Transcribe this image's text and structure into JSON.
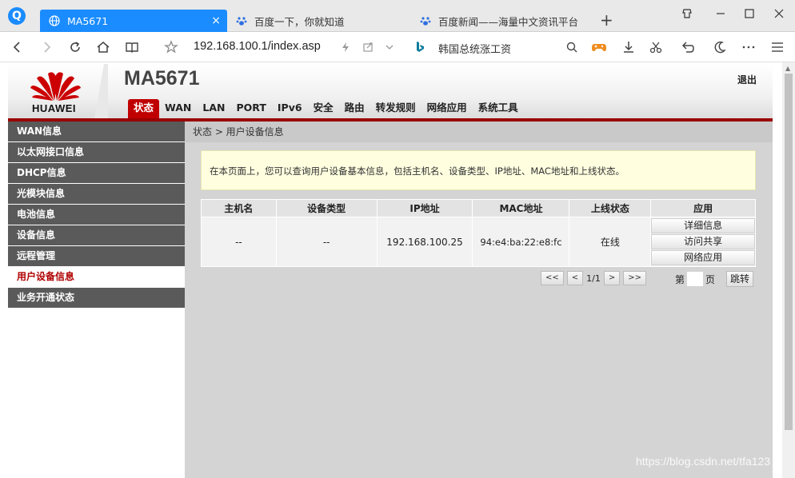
{
  "browser": {
    "logo": "Q",
    "tabs": [
      {
        "label": "MA5671",
        "close": "×"
      },
      {
        "label": "百度一下，你就知道"
      },
      {
        "label": "百度新闻——海量中文资讯平台"
      }
    ],
    "new_tab": "+",
    "url": "192.168.100.1/index.asp",
    "search_text": "韩国总统涨工资",
    "accent": "#1a8cff"
  },
  "header": {
    "brand": "HUAWEI",
    "model": "MA5671",
    "logout": "退出",
    "nav": [
      "状态",
      "WAN",
      "LAN",
      "PORT",
      "IPv6",
      "安全",
      "路由",
      "转发规则",
      "网络应用",
      "系统工具"
    ]
  },
  "sidebar": {
    "items": [
      "WAN信息",
      "以太网接口信息",
      "DHCP信息",
      "光模块信息",
      "电池信息",
      "设备信息",
      "远程管理",
      "用户设备信息",
      "业务开通状态"
    ]
  },
  "content": {
    "breadcrumb": "状态 > 用户设备信息",
    "info": "在本页面上，您可以查询用户设备基本信息，包括主机名、设备类型、IP地址、MAC地址和上线状态。",
    "table": {
      "headers": [
        "主机名",
        "设备类型",
        "IP地址",
        "MAC地址",
        "上线状态",
        "应用"
      ],
      "rows": [
        {
          "host": "--",
          "type": "--",
          "ip": "192.168.100.25",
          "mac": "94:e4:ba:22:e8:fc",
          "status": "在线"
        }
      ],
      "app_buttons": [
        "详细信息",
        "访问共享",
        "网络应用"
      ]
    },
    "pager": {
      "first": "<<",
      "prev": "<",
      "page": "1/1",
      "next": ">",
      "last": ">>",
      "goto_prefix": "第",
      "goto_suffix": "页",
      "goto_button": "跳转"
    }
  },
  "watermark": "https://blog.csdn.net/tfa123"
}
